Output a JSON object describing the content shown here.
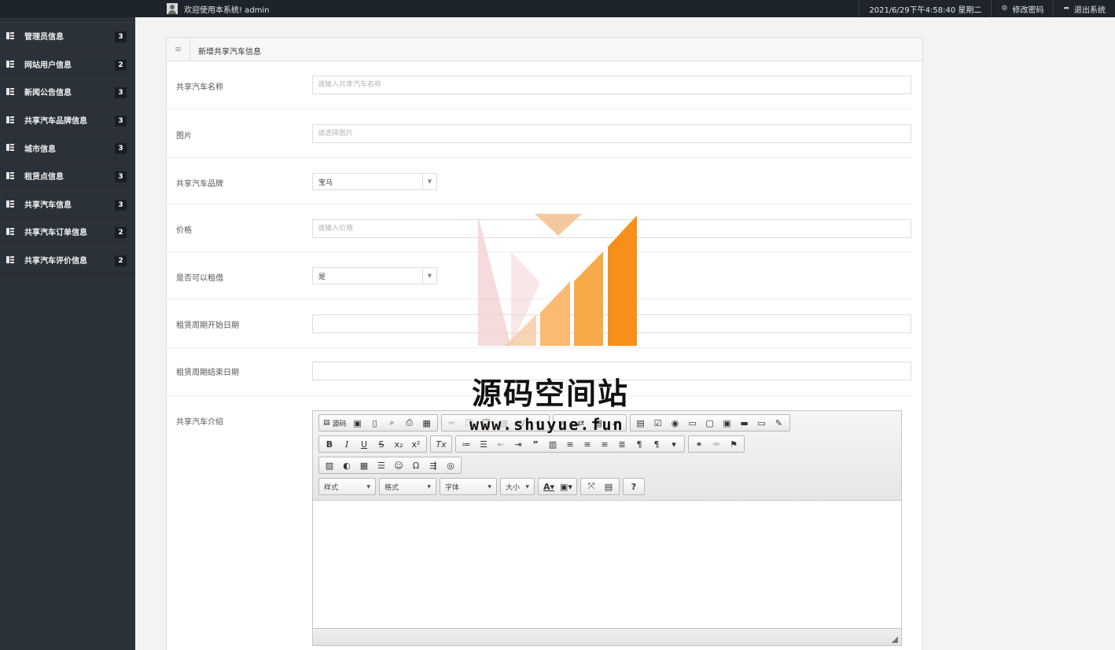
{
  "topbar": {
    "welcome": "欢迎使用本系统! admin",
    "datetime": "2021/6/29下午4:58:40 星期二",
    "change_password": "修改密码",
    "logout": "退出系统"
  },
  "sidebar": {
    "items": [
      {
        "label": "管理员信息",
        "count": "3"
      },
      {
        "label": "网站用户信息",
        "count": "2"
      },
      {
        "label": "新闻公告信息",
        "count": "3"
      },
      {
        "label": "共享汽车品牌信息",
        "count": "3"
      },
      {
        "label": "城市信息",
        "count": "3"
      },
      {
        "label": "租赁点信息",
        "count": "3"
      },
      {
        "label": "共享汽车信息",
        "count": "3"
      },
      {
        "label": "共享汽车订单信息",
        "count": "2"
      },
      {
        "label": "共享汽车评价信息",
        "count": "2"
      }
    ]
  },
  "panel": {
    "title": "新增共享汽车信息"
  },
  "form": {
    "name_label": "共享汽车名称",
    "name_placeholder": "请输入共享汽车名称",
    "image_label": "图片",
    "image_placeholder": "请选择图片",
    "brand_label": "共享汽车品牌",
    "brand_value": "宝马",
    "price_label": "价格",
    "price_placeholder": "请输入价格",
    "rentable_label": "是否可以租借",
    "rentable_value": "是",
    "start_label": "租赁周期开始日期",
    "end_label": "租赁周期结束日期",
    "intro_label": "共享汽车介绍"
  },
  "editor": {
    "source_label": "源码",
    "style_combo": "样式",
    "format_combo": "格式",
    "font_combo": "字体",
    "size_combo": "大小"
  },
  "watermark": {
    "title": "源码空间站",
    "url": "www.shuyue.fun"
  },
  "colors": {
    "sidebar_bg": "#2b3139",
    "topbar_bg": "#1e242c",
    "page_bg": "#f3f3f3",
    "watermark_orange": "#f7931e",
    "watermark_pink": "#f2c6c6"
  }
}
